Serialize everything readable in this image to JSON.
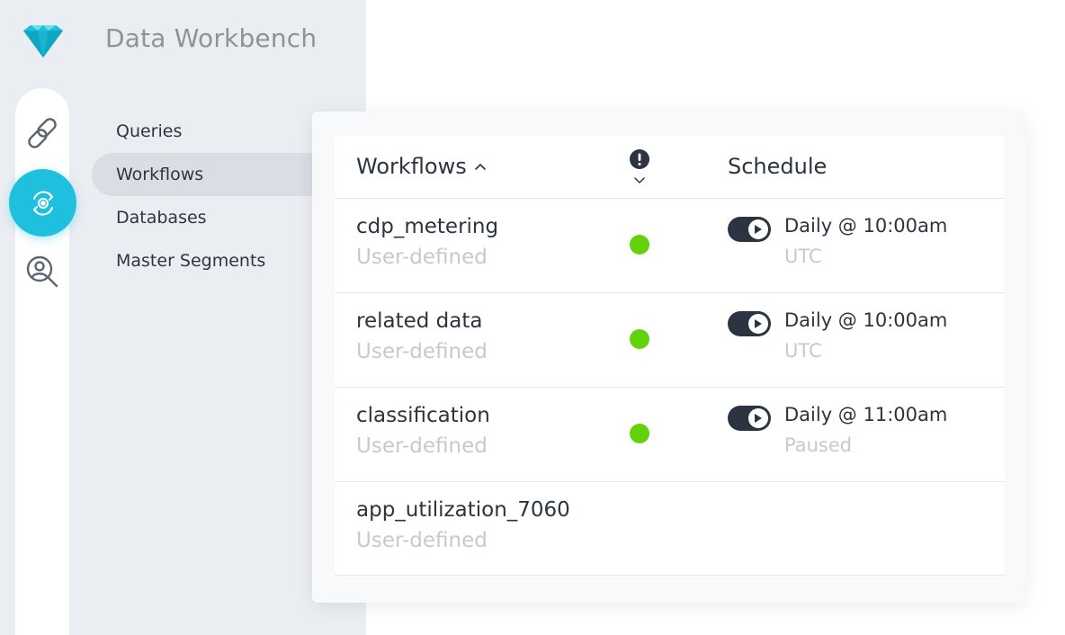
{
  "app": {
    "title": "Data Workbench",
    "logo_icon": "diamond-logo",
    "accent_color": "#1ec0de"
  },
  "rail": {
    "items": [
      {
        "icon": "link-icon",
        "active": false
      },
      {
        "icon": "workflow-gear-icon",
        "active": true
      },
      {
        "icon": "user-search-icon",
        "active": false
      }
    ]
  },
  "nav": {
    "items": [
      {
        "label": "Queries",
        "active": false
      },
      {
        "label": "Workflows",
        "active": true
      },
      {
        "label": "Databases",
        "active": false
      },
      {
        "label": "Master Segments",
        "active": false
      }
    ]
  },
  "table": {
    "headers": {
      "workflows": "Workflows",
      "sort_icon": "chevron-up-icon",
      "alert_icon": "exclamation-circle-icon",
      "alert_dropdown_icon": "chevron-down-icon",
      "schedule": "Schedule"
    },
    "status_color": "#62d30a",
    "rows": [
      {
        "name": "cdp_metering",
        "type": "User-defined",
        "has_status": true,
        "schedule": "Daily @ 10:00am",
        "schedule_sub": "UTC"
      },
      {
        "name": "related data",
        "type": "User-defined",
        "has_status": true,
        "schedule": "Daily @ 10:00am",
        "schedule_sub": "UTC"
      },
      {
        "name": "classification",
        "type": "User-defined",
        "has_status": true,
        "schedule": "Daily @ 11:00am",
        "schedule_sub": "Paused"
      },
      {
        "name": "app_utilization_7060",
        "type": "User-defined",
        "has_status": false,
        "schedule": "",
        "schedule_sub": ""
      }
    ]
  }
}
